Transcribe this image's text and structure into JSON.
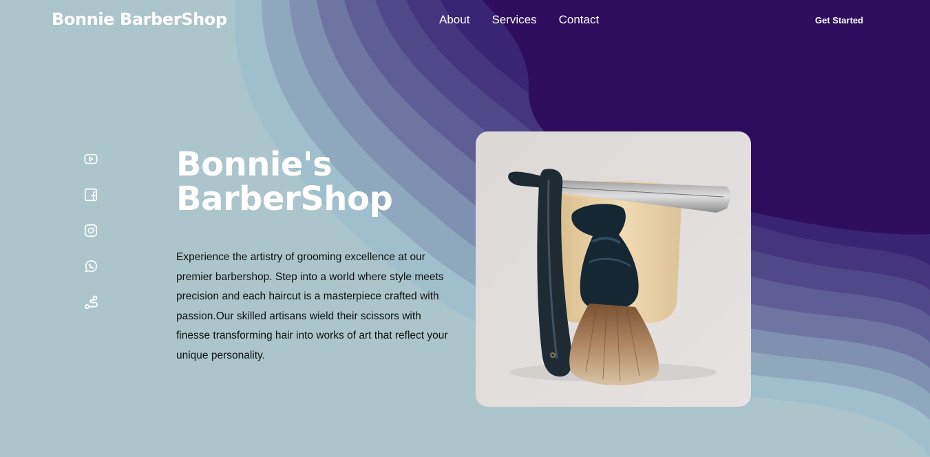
{
  "header": {
    "logo": "Bonnie BarberShop",
    "nav": [
      "About",
      "Services",
      "Contact"
    ],
    "cta_label": "Get Started"
  },
  "social": {
    "icons": [
      "youtube-icon",
      "facebook-icon",
      "instagram-icon",
      "whatsapp-icon",
      "route-icon"
    ]
  },
  "hero": {
    "title_line1": "Bonnie's",
    "title_line2": "BarberShop",
    "description": "Experience the artistry of grooming excellence at our premier barbershop. Step into a world where style meets precision and each haircut is a masterpiece crafted with passion.Our skilled artisans wield their scissors with finesse transforming hair into works of art that reflect your unique personality.",
    "image_subject": "straight razor and shaving brush with shaving mug"
  },
  "colors": {
    "background_light": "#acc5cc",
    "background_dark": "#2e0d5f",
    "text_white": "#ffffff",
    "text_dark": "#111111"
  }
}
